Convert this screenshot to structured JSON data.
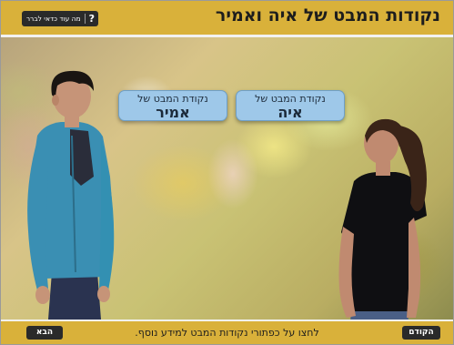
{
  "header": {
    "title": "נקודות המבט של איה ואמיר",
    "help_icon": "?",
    "help_label": "מה עוד כדאי לברר"
  },
  "scene": {
    "pov_buttons": [
      {
        "line1": "נקודת המבט של",
        "line2": "אמיר"
      },
      {
        "line1": "נקודת המבט של",
        "line2": "איה"
      }
    ]
  },
  "footer": {
    "instruction": "לחצו על כפתורי נקודות המבט למידע נוסף.",
    "next_label": "הבא",
    "prev_label": "הקודם"
  },
  "colors": {
    "bar": "#d9b13a",
    "button_dark": "#2a2a2a",
    "pov_button": "#9ec8e9"
  }
}
